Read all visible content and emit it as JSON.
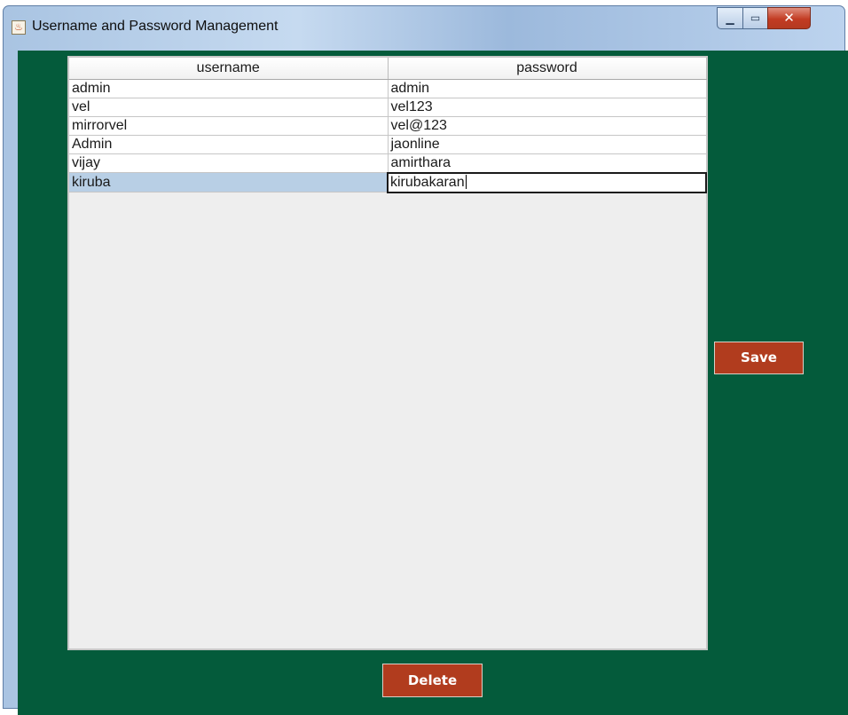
{
  "window": {
    "title": "Username and Password Management",
    "app_icon": "java-icon",
    "controls": {
      "minimize": "minimize-icon",
      "maximize": "maximize-icon",
      "close": "close-icon"
    }
  },
  "table": {
    "columns": [
      "username",
      "password"
    ],
    "rows": [
      {
        "username": "admin",
        "password": "admin"
      },
      {
        "username": "vel",
        "password": "vel123"
      },
      {
        "username": "mirrorvel",
        "password": "vel@123"
      },
      {
        "username": "Admin",
        "password": "jaonline"
      },
      {
        "username": "vijay",
        "password": "amirthara"
      },
      {
        "username": "kiruba",
        "password": "kirubakaran"
      }
    ],
    "selected_row": 5,
    "editing_column": "password"
  },
  "buttons": {
    "save_label": "Save",
    "delete_label": "Delete"
  },
  "colors": {
    "panel_background": "#045b3b",
    "button_background": "#b13c1e",
    "selection": "#b8cfe5",
    "title_bar": "#c6daf0"
  }
}
